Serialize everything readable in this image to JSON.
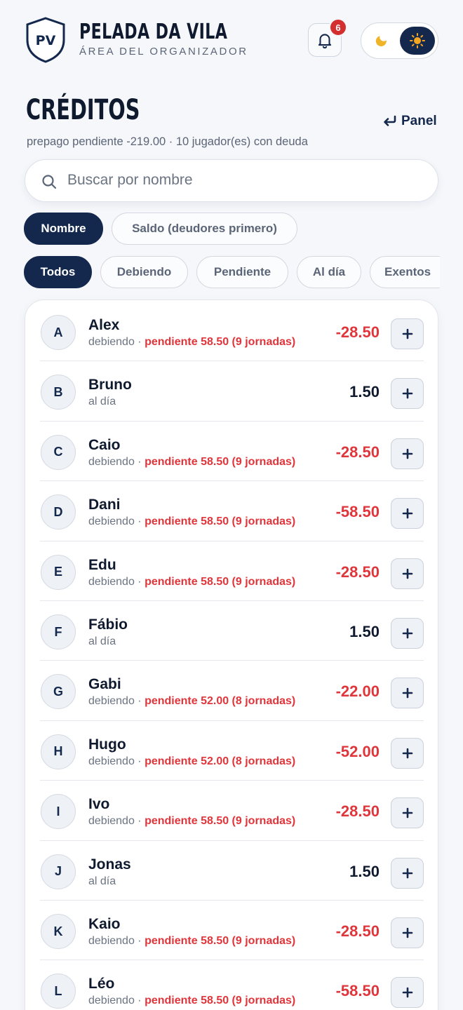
{
  "header": {
    "logo_text": "PV",
    "title": "PELADA DA VILA",
    "subtitle": "ÁREA DEL ORGANIZADOR",
    "notification_count": "6"
  },
  "page": {
    "title": "CRÉDITOS",
    "back_link": "Panel",
    "summary": "prepago pendiente -219.00 · 10 jugador(es) con deuda"
  },
  "search": {
    "placeholder": "Buscar por nombre",
    "value": ""
  },
  "sort_options": [
    {
      "label": "Nombre",
      "active": true
    },
    {
      "label": "Saldo (deudores primero)",
      "active": false
    }
  ],
  "filter_options": [
    {
      "label": "Todos",
      "active": true
    },
    {
      "label": "Debiendo",
      "active": false
    },
    {
      "label": "Pendiente",
      "active": false
    },
    {
      "label": "Al día",
      "active": false
    },
    {
      "label": "Exentos",
      "active": false
    }
  ],
  "players": [
    {
      "initial": "A",
      "name": "Alex",
      "status": "debiendo",
      "pending": "pendiente 58.50 (9 jornadas)",
      "balance": "-28.50",
      "negative": true
    },
    {
      "initial": "B",
      "name": "Bruno",
      "status": "al día",
      "pending": "",
      "balance": "1.50",
      "negative": false
    },
    {
      "initial": "C",
      "name": "Caio",
      "status": "debiendo",
      "pending": "pendiente 58.50 (9 jornadas)",
      "balance": "-28.50",
      "negative": true
    },
    {
      "initial": "D",
      "name": "Dani",
      "status": "debiendo",
      "pending": "pendiente 58.50 (9 jornadas)",
      "balance": "-58.50",
      "negative": true
    },
    {
      "initial": "E",
      "name": "Edu",
      "status": "debiendo",
      "pending": "pendiente 58.50 (9 jornadas)",
      "balance": "-28.50",
      "negative": true
    },
    {
      "initial": "F",
      "name": "Fábio",
      "status": "al día",
      "pending": "",
      "balance": "1.50",
      "negative": false
    },
    {
      "initial": "G",
      "name": "Gabi",
      "status": "debiendo",
      "pending": "pendiente 52.00 (8 jornadas)",
      "balance": "-22.00",
      "negative": true
    },
    {
      "initial": "H",
      "name": "Hugo",
      "status": "debiendo",
      "pending": "pendiente 52.00 (8 jornadas)",
      "balance": "-52.00",
      "negative": true
    },
    {
      "initial": "I",
      "name": "Ivo",
      "status": "debiendo",
      "pending": "pendiente 58.50 (9 jornadas)",
      "balance": "-28.50",
      "negative": true
    },
    {
      "initial": "J",
      "name": "Jonas",
      "status": "al día",
      "pending": "",
      "balance": "1.50",
      "negative": false
    },
    {
      "initial": "K",
      "name": "Kaio",
      "status": "debiendo",
      "pending": "pendiente 58.50 (9 jornadas)",
      "balance": "-28.50",
      "negative": true
    },
    {
      "initial": "L",
      "name": "Léo",
      "status": "debiendo",
      "pending": "pendiente 58.50 (9 jornadas)",
      "balance": "-58.50",
      "negative": true
    }
  ],
  "colors": {
    "primary": "#14284d",
    "debt": "#e0353b",
    "badge": "#d32f2f",
    "background": "#f5f7fa"
  },
  "icons": {
    "logo": "shield-icon",
    "notifications": "bell-icon",
    "theme_dark": "moon-icon",
    "theme_light": "sun-icon",
    "back": "return-arrow-icon",
    "search": "search-icon",
    "add": "plus-icon"
  }
}
